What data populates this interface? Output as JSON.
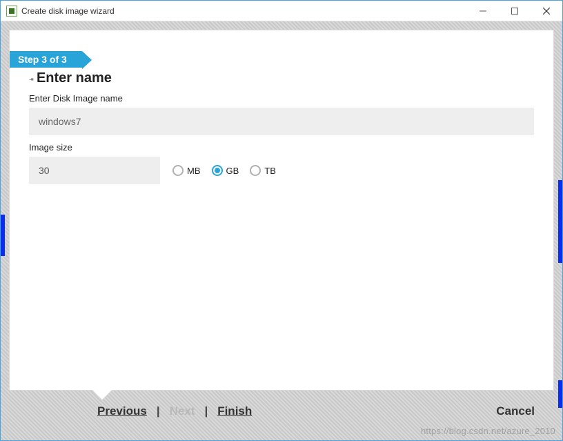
{
  "window": {
    "title": "Create disk image wizard"
  },
  "step": {
    "label": "Step 3 of 3",
    "heading": "Enter name"
  },
  "fields": {
    "name_label": "Enter Disk Image name",
    "name_value": "windows7",
    "size_label": "Image size",
    "size_value": "30"
  },
  "units": {
    "options": [
      {
        "value": "MB",
        "label": "MB",
        "selected": false
      },
      {
        "value": "GB",
        "label": "GB",
        "selected": true
      },
      {
        "value": "TB",
        "label": "TB",
        "selected": false
      }
    ]
  },
  "nav": {
    "previous": "Previous",
    "next": "Next",
    "next_disabled": true,
    "finish": "Finish",
    "cancel": "Cancel",
    "separator": "|"
  },
  "watermark": "https://blog.csdn.net/azure_2010"
}
